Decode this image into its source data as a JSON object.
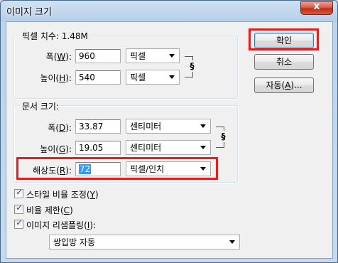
{
  "window": {
    "title": "이미지 크기",
    "close_label": "x"
  },
  "pixel_dimensions": {
    "legend": "픽셀 치수: 1.48M",
    "width": {
      "label_prefix": "폭(",
      "mnemonic": "W",
      "label_suffix": "):",
      "value": "960",
      "unit": "픽셀"
    },
    "height": {
      "label_prefix": "높이(",
      "mnemonic": "H",
      "label_suffix": "):",
      "value": "540",
      "unit": "픽셀"
    }
  },
  "document_size": {
    "legend": "문서 크기:",
    "width": {
      "label_prefix": "폭(",
      "mnemonic": "D",
      "label_suffix": "):",
      "value": "33.87",
      "unit": "센티미터"
    },
    "height": {
      "label_prefix": "높이(",
      "mnemonic": "G",
      "label_suffix": "):",
      "value": "19.05",
      "unit": "센티미터"
    },
    "resolution": {
      "label_prefix": "해상도(",
      "mnemonic": "R",
      "label_suffix": "):",
      "value": "72",
      "unit": "픽셀/인치"
    }
  },
  "buttons": {
    "ok": "확인",
    "cancel": "취소",
    "auto_prefix": "자동(",
    "auto_mnemonic": "A",
    "auto_suffix": ")..."
  },
  "options": {
    "scale_styles": {
      "prefix": "스타일 비율 조정(",
      "mnemonic": "Y",
      "suffix": ")",
      "checked": true
    },
    "constrain": {
      "prefix": "비율 제한(",
      "mnemonic": "C",
      "suffix": ")",
      "checked": true
    },
    "resample": {
      "prefix": "이미지 리샘플링(",
      "mnemonic": "I",
      "suffix": "):",
      "checked": true
    },
    "resample_method": "쌍입방 자동",
    "check_glyph": "✓"
  },
  "colors": {
    "highlight": "#e02020",
    "selection": "#3399ff"
  }
}
